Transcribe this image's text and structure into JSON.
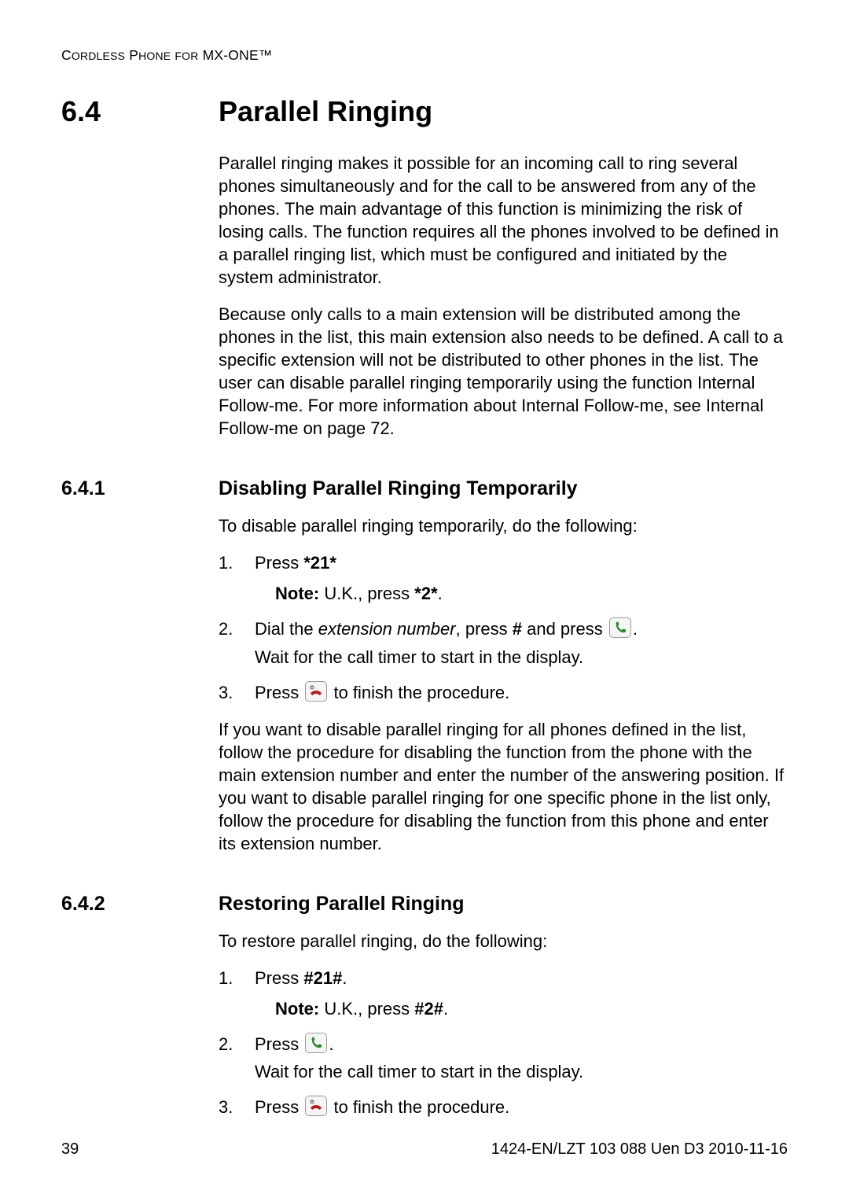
{
  "header": {
    "text": "Cordless Phone for MX-ONE™"
  },
  "section": {
    "number": "6.4",
    "title": "Parallel Ringing",
    "intro_p1": "Parallel ringing makes it possible for an incoming call to ring several phones simultaneously and for the call to be answered from any of the phones. The main advantage of this function is minimizing the risk of losing calls. The function requires all the phones involved to be defined in a parallel ringing list, which must be configured and initiated by the system administrator.",
    "intro_p2": "Because only calls to a main extension will be distributed among the phones in the list, this main extension also needs to be defined. A call to a specific extension will not be distributed to other phones in the list. The user can disable parallel ringing temporarily using the function Internal Follow-me. For more information about Internal Follow-me, see Internal Follow-me on page 72."
  },
  "sub1": {
    "number": "6.4.1",
    "title": "Disabling Parallel Ringing Temporarily",
    "lead": "To disable parallel ringing temporarily, do the following:",
    "step1_a": "Press ",
    "step1_b": "*21*",
    "note1_label": "Note:",
    "note1_a": "  U.K., press ",
    "note1_b": "*2*",
    "note1_c": ".",
    "step2_a": "Dial the ",
    "step2_b": "extension number",
    "step2_c": ", press ",
    "step2_d": "#",
    "step2_e": " and press ",
    "step2_f": ".",
    "step2_sub": "Wait for the call timer to start in the display.",
    "step3_a": "Press ",
    "step3_b": " to finish the procedure.",
    "tail": "If you want to disable parallel ringing for all phones defined in the list, follow the procedure for disabling the function from the phone with the main extension number and enter the number of the answering position. If you want to disable parallel ringing for one specific phone in the list only, follow the procedure for disabling the function from this phone and enter its extension number."
  },
  "sub2": {
    "number": "6.4.2",
    "title": "Restoring Parallel Ringing",
    "lead": "To restore parallel ringing, do the following:",
    "step1_a": "Press ",
    "step1_b": "#21#",
    "step1_c": ".",
    "note1_label": "Note:",
    "note1_a": "  U.K., press ",
    "note1_b": "#2#",
    "note1_c": ".",
    "step2_a": "Press ",
    "step2_b": ".",
    "step2_sub": "Wait for the call timer to start in the display.",
    "step3_a": "Press ",
    "step3_b": " to finish the procedure."
  },
  "footer": {
    "page": "39",
    "doc_id": "1424-EN/LZT 103 088 Uen D3 2010-11-16"
  }
}
